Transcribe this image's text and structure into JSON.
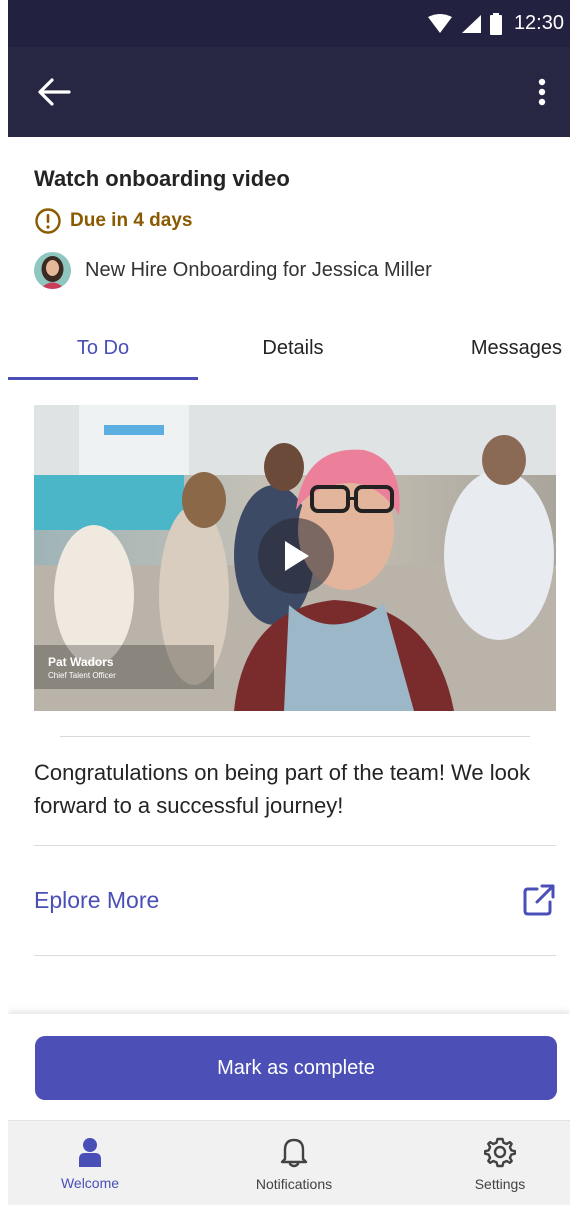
{
  "status_bar": {
    "time": "12:30"
  },
  "app_bar": {
    "back_icon": "arrow-left-icon",
    "more_icon": "more-vertical-icon"
  },
  "task": {
    "title": "Watch onboarding video",
    "due": "Due in 4 days",
    "plan": "New Hire Onboarding for Jessica Miller"
  },
  "tabs": [
    {
      "label": "To Do",
      "active": true
    },
    {
      "label": "Details",
      "active": false
    },
    {
      "label": "Messages",
      "active": false
    }
  ],
  "video": {
    "speaker_name": "Pat Wadors",
    "speaker_role": "Chief Talent Officer"
  },
  "message": "Congratulations on being part of the team! We look forward to a successful journey!",
  "explore_link": {
    "label": "Eplore More",
    "icon": "open-external-icon"
  },
  "complete_button": {
    "label": "Mark as complete"
  },
  "bottom_nav": [
    {
      "label": "Welcome",
      "icon": "person-icon",
      "active": true
    },
    {
      "label": "Notifications",
      "icon": "bell-icon",
      "active": false
    },
    {
      "label": "Settings",
      "icon": "gear-icon",
      "active": false
    }
  ],
  "colors": {
    "header": "#272744",
    "accent": "#4a4fb8",
    "due_warning": "#8a5a00"
  }
}
